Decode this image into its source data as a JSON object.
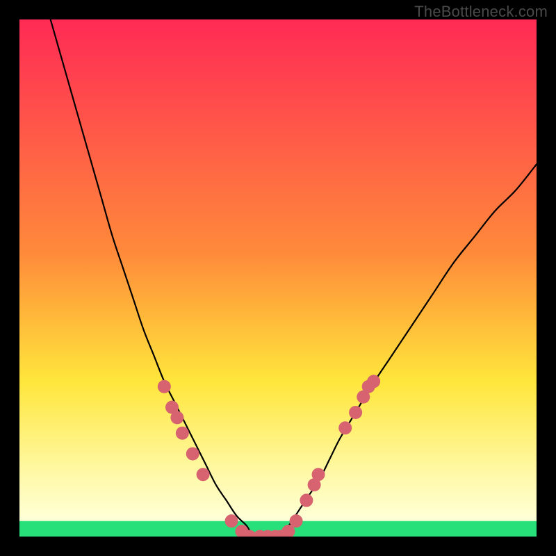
{
  "watermark": "TheBottleneck.com",
  "chart_data": {
    "type": "line",
    "title": "",
    "xlabel": "",
    "ylabel": "",
    "xlim": [
      0,
      100
    ],
    "ylim": [
      0,
      100
    ],
    "grid": false,
    "legend": false,
    "background_gradient": {
      "stops": [
        {
          "pct": 0,
          "color": "#ff2a55"
        },
        {
          "pct": 45,
          "color": "#ff8a3a"
        },
        {
          "pct": 70,
          "color": "#ffe63b"
        },
        {
          "pct": 88,
          "color": "#fff9a8"
        },
        {
          "pct": 97,
          "color": "#ffffd8"
        },
        {
          "pct": 100,
          "color": "#28e07a"
        }
      ]
    },
    "green_band": {
      "y_top_pct": 97,
      "y_bottom_pct": 100,
      "color": "#28e07a"
    },
    "series": [
      {
        "name": "left-curve",
        "x": [
          6,
          8,
          10,
          12,
          14,
          16,
          18,
          20,
          22,
          24,
          26,
          28,
          30,
          32,
          34,
          36,
          38,
          40,
          42,
          44,
          45
        ],
        "y": [
          100,
          93,
          86,
          79,
          72,
          65,
          58,
          52,
          46,
          40,
          35,
          30,
          26,
          22,
          18,
          14,
          10,
          7,
          4,
          2,
          0
        ]
      },
      {
        "name": "right-curve",
        "x": [
          50,
          52,
          54,
          56,
          58,
          60,
          62,
          65,
          68,
          72,
          76,
          80,
          84,
          88,
          92,
          96,
          100
        ],
        "y": [
          0,
          2,
          5,
          8,
          11,
          15,
          19,
          24,
          29,
          35,
          41,
          47,
          53,
          58,
          63,
          67,
          72
        ]
      },
      {
        "name": "flat-bottom",
        "x": [
          45,
          46,
          47,
          48,
          49,
          50
        ],
        "y": [
          0,
          0,
          0,
          0,
          0,
          0
        ]
      }
    ],
    "points_left": [
      {
        "x": 28.0,
        "y": 29
      },
      {
        "x": 29.5,
        "y": 25
      },
      {
        "x": 30.5,
        "y": 23
      },
      {
        "x": 31.5,
        "y": 20
      },
      {
        "x": 33.5,
        "y": 16
      },
      {
        "x": 35.5,
        "y": 12
      },
      {
        "x": 41.0,
        "y": 3
      },
      {
        "x": 43.0,
        "y": 1
      },
      {
        "x": 44.5,
        "y": 0
      }
    ],
    "points_right": [
      {
        "x": 50.5,
        "y": 0
      },
      {
        "x": 52.0,
        "y": 1
      },
      {
        "x": 53.5,
        "y": 3
      },
      {
        "x": 55.5,
        "y": 7
      },
      {
        "x": 57.0,
        "y": 10
      },
      {
        "x": 57.8,
        "y": 12
      },
      {
        "x": 63.0,
        "y": 21
      },
      {
        "x": 65.0,
        "y": 24
      },
      {
        "x": 66.5,
        "y": 27
      },
      {
        "x": 67.5,
        "y": 29
      },
      {
        "x": 68.5,
        "y": 30
      }
    ],
    "points_flat": [
      {
        "x": 46.5,
        "y": 0
      },
      {
        "x": 48.0,
        "y": 0
      },
      {
        "x": 49.5,
        "y": 0
      }
    ],
    "point_style": {
      "radius": 9.5,
      "fill": "#d6636f"
    }
  }
}
